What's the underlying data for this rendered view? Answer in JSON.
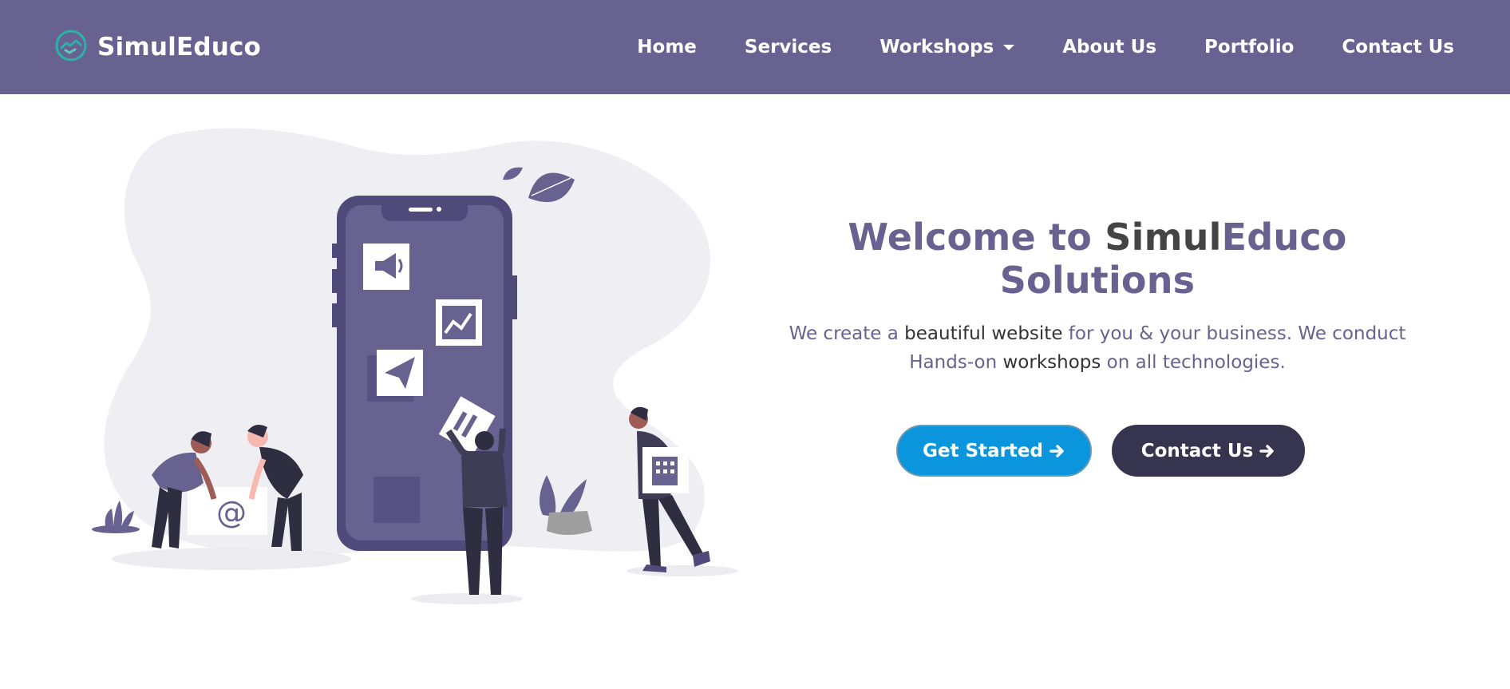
{
  "brand": {
    "name": "SimulEduco",
    "logo_icon": "handshake-circle-icon"
  },
  "nav": {
    "items": [
      {
        "label": "Home"
      },
      {
        "label": "Services"
      },
      {
        "label": "Workshops",
        "has_dropdown": true
      },
      {
        "label": "About Us"
      },
      {
        "label": "Portfolio"
      },
      {
        "label": "Contact Us"
      }
    ]
  },
  "hero": {
    "title_part1": "Welcome to ",
    "title_part2": "Simul",
    "title_part3": "Educo Solutions",
    "desc_part1": "We create a ",
    "desc_part2": "beautiful website",
    "desc_part3": " for you & your business. We conduct ",
    "desc_part4": "Hands-on",
    "desc_part5": " workshops",
    "desc_part6": " on all technologies.",
    "buttons": {
      "get_started": "Get Started",
      "contact_us": "Contact Us"
    },
    "illustration_text": "@"
  },
  "colors": {
    "navbar": "#67628f",
    "accent": "#67628f",
    "primary_button": "#0b95dd",
    "dark_button": "#37344f"
  }
}
